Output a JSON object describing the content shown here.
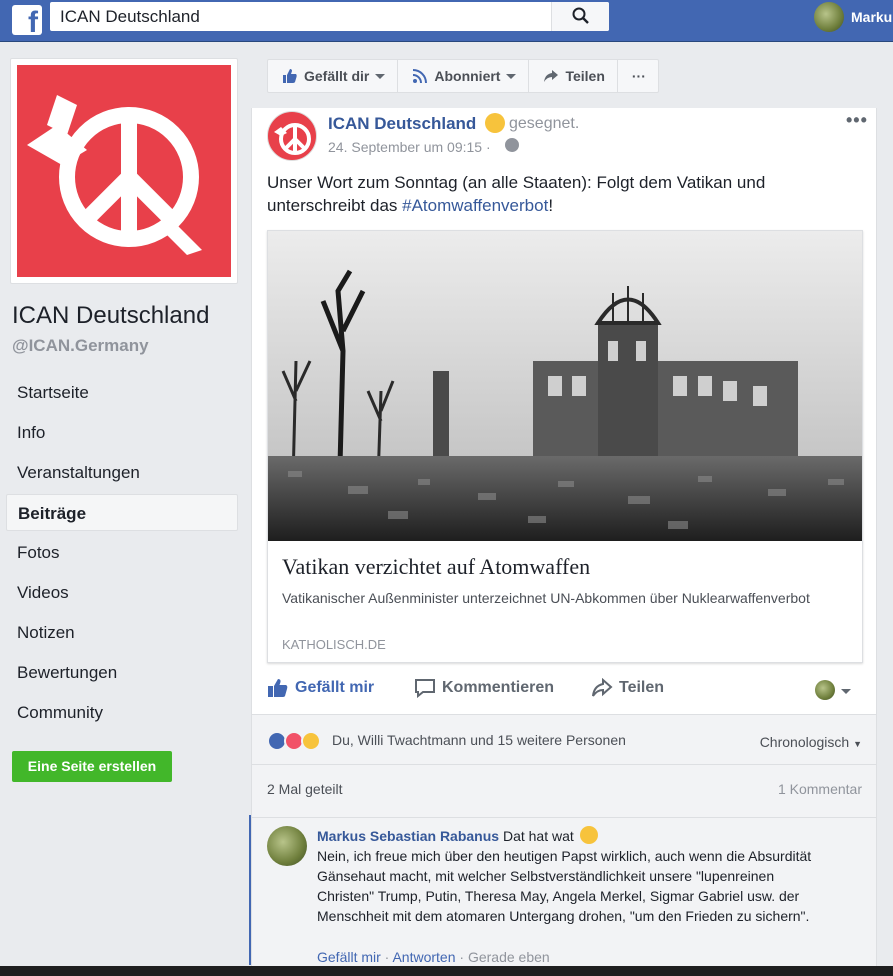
{
  "topbar": {
    "search_value": "ICAN Deutschland",
    "user_name": "Marku"
  },
  "sidebar": {
    "page_name": "ICAN Deutschland",
    "page_handle": "@ICAN.Germany",
    "items": [
      {
        "label": "Startseite"
      },
      {
        "label": "Info"
      },
      {
        "label": "Veranstaltungen"
      },
      {
        "label": "Beiträge"
      },
      {
        "label": "Fotos"
      },
      {
        "label": "Videos"
      },
      {
        "label": "Notizen"
      },
      {
        "label": "Bewertungen"
      },
      {
        "label": "Community"
      }
    ],
    "create_page": "Eine Seite erstellen"
  },
  "action_bar": {
    "like": "Gefällt dir",
    "follow": "Abonniert",
    "share": "Teilen",
    "more": "···"
  },
  "post": {
    "author": "ICAN Deutschland",
    "feeling": "gesegnet.",
    "date": "24. September um 09:15 ·",
    "text_before": "Unser Wort zum Sonntag (an alle Staaten): Folgt dem Vatikan und unterschreibt das ",
    "hashtag": "#Atomwaffenverbot",
    "text_after": "!",
    "link": {
      "title": "Vatikan verzichtet auf Atomwaffen",
      "description": "Vatikanischer Außenminister unterzeichnet UN-Abkommen über Nuklearwaffenverbot",
      "domain": "KATHOLISCH.DE"
    },
    "actions": {
      "like": "Gefällt mir",
      "comment": "Kommentieren",
      "share": "Teilen"
    },
    "reactions_text": "Du, Willi Twachtmann und 15 weitere Personen",
    "sort": "Chronologisch",
    "shares": "2 Mal geteilt",
    "comments_count": "1 Kommentar"
  },
  "comment": {
    "author": "Markus Sebastian Rabanus",
    "first_line": "Dat hat wat",
    "text": "Nein, ich freue mich über den heutigen Papst wirklich, auch wenn die Absurdität Gänsehaut macht, mit welcher Selbstverständlichkeit unsere \"lupenreinen Christen\" Trump, Putin, Theresa May, Angela Merkel, Sigmar Gabriel usw. der Menschheit mit dem atomaren Untergang drohen, \"um den Frieden zu sichern\".",
    "like": "Gefällt mir",
    "reply": "Antworten",
    "time": "Gerade eben"
  },
  "colors": {
    "brand": "#4267b2",
    "ican_red": "#e8404a",
    "green_button": "#42b72a"
  }
}
